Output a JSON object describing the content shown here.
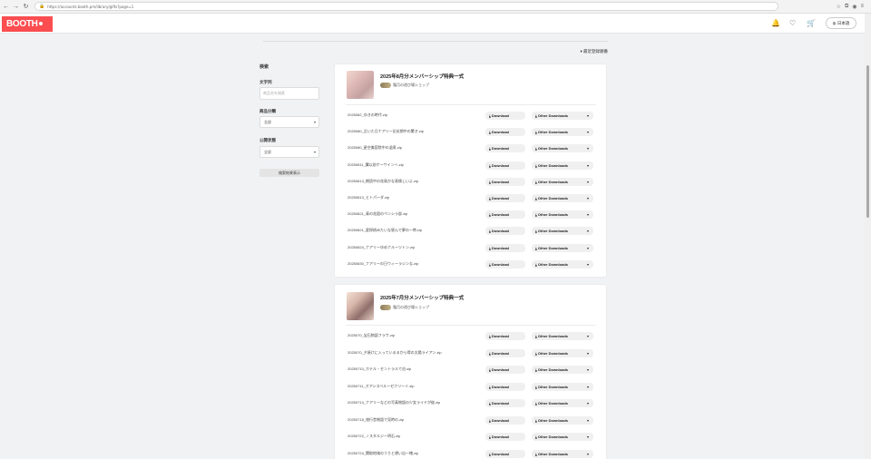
{
  "browser": {
    "url": "https://accounts.booth.pm/library/gifts?page=1",
    "back_icon": "←",
    "forward_icon": "→",
    "reload_icon": "↻"
  },
  "header": {
    "logo": "BOOTH",
    "lang_label": "日本語"
  },
  "toolbar": {
    "sort_label": "▾ 最近登録順番"
  },
  "sidebar": {
    "title": "検索",
    "keyword_label": "文字列",
    "keyword_placeholder": "商品名を検索",
    "category_label": "商品分類",
    "category_value": "全部",
    "status_label": "公開状態",
    "status_value": "全部",
    "search_button": "検索結果表示"
  },
  "cards": [
    {
      "title": "2025年8月分メンバーシップ特典一式",
      "shop": "霜月の遊び場ショップ",
      "files": [
        "2025082_ゆきの時代.zip",
        "2025080_泣いた日ナアリー反抗期中の驚き.zip",
        "2025080_星空美容院中の温泉.zip",
        "20250811_翼以前ケーサインヘ.zip",
        "20250813_朗読中の花鳥かな表情しいよ.zip",
        "20250813_ヒトパーダ.zip",
        "20250821_青の花園のペンシラ部.zip",
        "20250821_夏探偵みたいな昼んで夢の一時.zip",
        "20250824_ナアリーゆめナルーツトン.zip",
        "20250830_ナアリーの日ウィーラジンな.zip"
      ]
    },
    {
      "title": "2025年7月分メンバーシップ特典一式",
      "shop": "霜月の遊び場ショップ",
      "files": [
        "2025070_宝石物語フラワ.zip",
        "2025070_夕焼けに入っているるから得の太陽ライアン.zip",
        "20250710_ホテル・セントラルで泊.zip",
        "20250711_オアシスベルーゼクリーミ.zip",
        "20250714_ナアリーなどの写真物語の少女ライドが彼.zip",
        "20250718_旅行昔物語で見時の.zip",
        "20250722_ノスタルジー明石.zip",
        "20250724_関取地域のうりと想い出一緒.zip"
      ]
    }
  ],
  "labels": {
    "download": "Download",
    "other_downloads": "Other Downloads"
  }
}
